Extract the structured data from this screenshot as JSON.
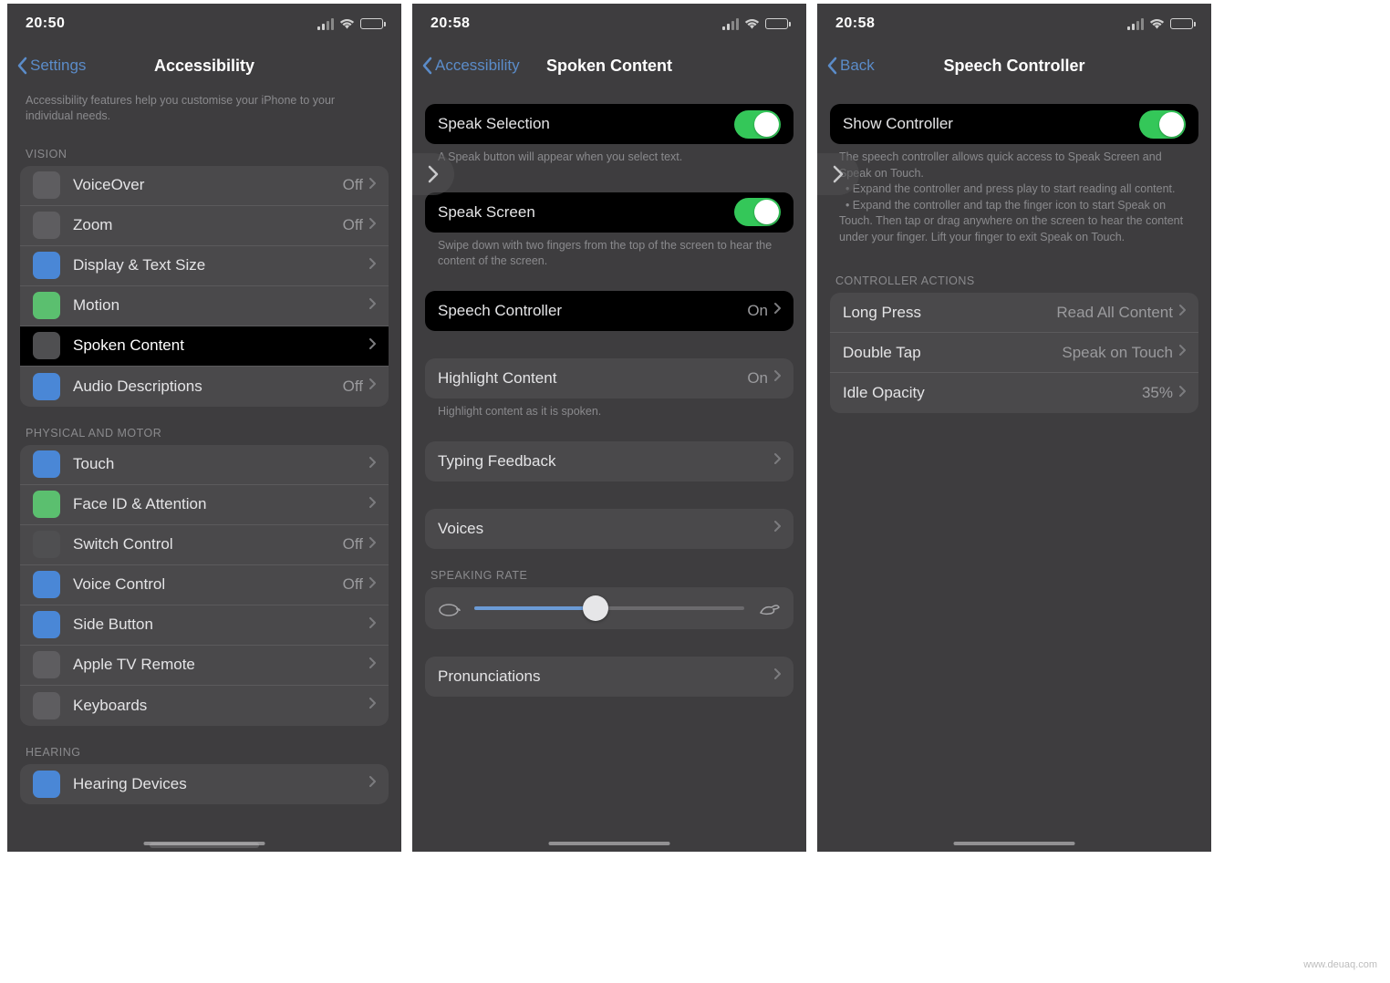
{
  "watermark": "www.deuaq.com",
  "screens": [
    {
      "time": "20:50",
      "back_label": "Settings",
      "title": "Accessibility",
      "intro": "Accessibility features help you customise your iPhone to your individual needs.",
      "sections": [
        {
          "header": "VISION",
          "items": [
            {
              "icon_color": "ic-gray",
              "label": "VoiceOver",
              "value": "Off"
            },
            {
              "icon_color": "ic-gray",
              "label": "Zoom",
              "value": "Off"
            },
            {
              "icon_color": "ic-blue",
              "label": "Display & Text Size"
            },
            {
              "icon_color": "ic-green",
              "label": "Motion"
            },
            {
              "icon_color": "ic-dark",
              "label": "Spoken Content",
              "highlight": true
            },
            {
              "icon_color": "ic-blue",
              "label": "Audio Descriptions",
              "value": "Off"
            }
          ]
        },
        {
          "header": "PHYSICAL AND MOTOR",
          "items": [
            {
              "icon_color": "ic-blue",
              "label": "Touch"
            },
            {
              "icon_color": "ic-green",
              "label": "Face ID & Attention"
            },
            {
              "icon_color": "ic-dark",
              "label": "Switch Control",
              "value": "Off"
            },
            {
              "icon_color": "ic-blue",
              "label": "Voice Control",
              "value": "Off"
            },
            {
              "icon_color": "ic-blue",
              "label": "Side Button"
            },
            {
              "icon_color": "ic-gray",
              "label": "Apple TV Remote"
            },
            {
              "icon_color": "ic-gray",
              "label": "Keyboards"
            }
          ]
        },
        {
          "header": "HEARING",
          "items": [
            {
              "icon_color": "ic-blue",
              "label": "Hearing Devices"
            }
          ]
        }
      ]
    },
    {
      "time": "20:58",
      "back_label": "Accessibility",
      "title": "Spoken Content",
      "overlay_arrow": true,
      "blocks": [
        {
          "type": "toggle",
          "label": "Speak Selection",
          "on": true,
          "highlight": true
        },
        {
          "type": "footer",
          "text": "A Speak button will appear when you select text."
        },
        {
          "type": "toggle",
          "label": "Speak Screen",
          "on": true,
          "highlight": true
        },
        {
          "type": "footer",
          "text": "Swipe down with two fingers from the top of the screen to hear the content of the screen."
        },
        {
          "type": "link",
          "label": "Speech Controller",
          "value": "On",
          "highlight": true
        },
        {
          "type": "spacer"
        },
        {
          "type": "link",
          "label": "Highlight Content",
          "value": "On"
        },
        {
          "type": "footer",
          "text": "Highlight content as it is spoken."
        },
        {
          "type": "link",
          "label": "Typing Feedback"
        },
        {
          "type": "spacer"
        },
        {
          "type": "link",
          "label": "Voices"
        },
        {
          "type": "header",
          "text": "SPEAKING RATE"
        },
        {
          "type": "slider",
          "percent": 45
        },
        {
          "type": "spacer"
        },
        {
          "type": "link",
          "label": "Pronunciations"
        }
      ]
    },
    {
      "time": "20:58",
      "back_label": "Back",
      "title": "Speech Controller",
      "overlay_arrow": true,
      "blocks": [
        {
          "type": "toggle",
          "label": "Show Controller",
          "on": true,
          "highlight": true
        },
        {
          "type": "bulletdesc",
          "lead": "The speech controller allows quick access to Speak Screen and Speak on Touch.",
          "bullets": [
            "Expand the controller and press play to start reading all content.",
            "Expand the controller and tap the finger icon to start Speak on Touch. Then tap or drag anywhere on the screen to hear the content under your finger. Lift your finger to exit Speak on Touch."
          ]
        },
        {
          "type": "header",
          "text": "CONTROLLER ACTIONS"
        },
        {
          "type": "link_group",
          "items": [
            {
              "label": "Long Press",
              "value": "Read All Content"
            },
            {
              "label": "Double Tap",
              "value": "Speak on Touch"
            },
            {
              "label": "Idle Opacity",
              "value": "35%"
            }
          ]
        }
      ]
    }
  ]
}
